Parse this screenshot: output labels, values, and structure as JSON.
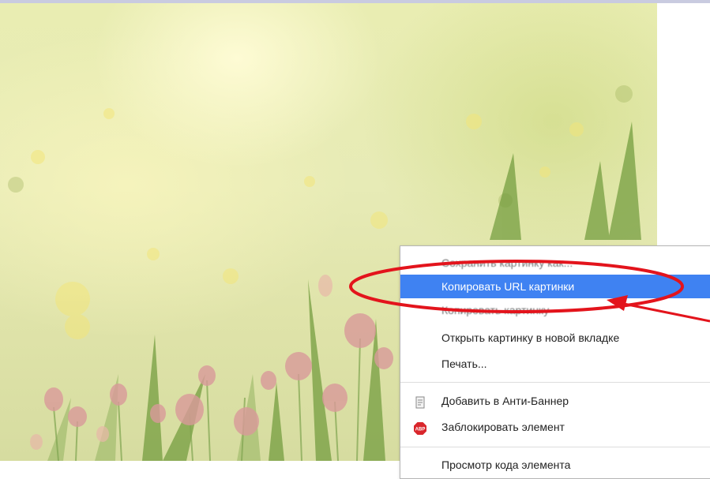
{
  "context_menu": {
    "items": [
      {
        "label": "Сохранить картинку как..."
      },
      {
        "label": "Копировать URL картинки"
      },
      {
        "label": "Копировать картинку"
      },
      {
        "label": "Открыть картинку в новой вкладке"
      },
      {
        "label": "Печать..."
      },
      {
        "label": "Добавить в Анти-Баннер",
        "icon": "anti-banner-icon"
      },
      {
        "label": "Заблокировать элемент",
        "icon": "adblock-stop-icon"
      },
      {
        "label": "Просмотр кода элемента"
      }
    ],
    "highlighted_index": 1,
    "adblock_icon_text": "ABP"
  },
  "colors": {
    "highlight": "#3f82f2",
    "annotation": "#e3141c",
    "menu_text": "#222222"
  }
}
